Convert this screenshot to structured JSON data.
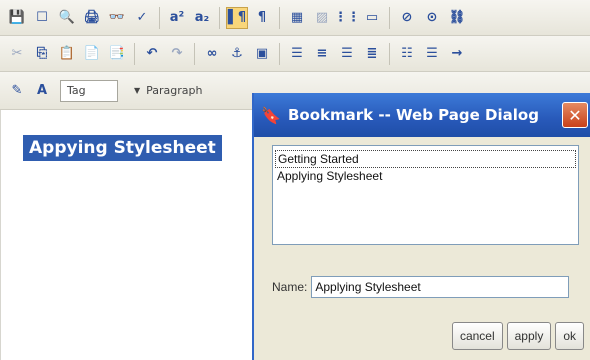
{
  "toolbar1": {
    "icons": [
      "save-icon",
      "new-page-icon",
      "preview-icon",
      "print-icon",
      "find-icon",
      "spellcheck-icon",
      "superscript-icon",
      "subscript-icon",
      "ltr-icon",
      "paragraph-mark-icon",
      "table-icon",
      "edit-table-icon",
      "grid-icon",
      "form-icon",
      "no-entry-icon",
      "target-icon",
      "link-chain-icon"
    ],
    "glyphs": [
      "💾",
      "☐",
      "🔍",
      "🖨",
      "👓",
      "✓",
      "a²",
      "a₂",
      "▌¶",
      "¶",
      "▦",
      "▨",
      "⋮⋮",
      "▭",
      "⊘",
      "⊙",
      "⛓"
    ]
  },
  "toolbar2": {
    "icons": [
      "cut-icon",
      "copy-icon",
      "paste-icon",
      "paste-text-icon",
      "paste-word-icon",
      "undo-icon",
      "redo-icon",
      "hyperlink-icon",
      "anchor-icon",
      "image-icon",
      "align-left-icon",
      "align-center-icon",
      "align-right-icon",
      "justify-icon",
      "ordered-list-icon",
      "unordered-list-icon",
      "indent-icon"
    ],
    "glyphs": [
      "✂",
      "⎘",
      "📋",
      "📄",
      "📑",
      "↶",
      "↷",
      "∞",
      "⚓",
      "▣",
      "☰",
      "≡",
      "☰",
      "≣",
      "☷",
      "☰",
      "→"
    ]
  },
  "toolbar3": {
    "style_icon": "style-icon",
    "format_icon": "format-icon",
    "tag_value": "Tag",
    "paragraph_value": "Paragraph"
  },
  "editor": {
    "heading": "Appying Stylesheet"
  },
  "dialog": {
    "title": "Bookmark -- Web Page Dialog",
    "close_glyph": "✕",
    "bookmarks": [
      "Getting Started",
      "Applying Stylesheet"
    ],
    "name_label": "Name:",
    "name_value": "Applying Stylesheet",
    "buttons": {
      "cancel": "cancel",
      "apply": "apply",
      "ok": "ok"
    }
  }
}
